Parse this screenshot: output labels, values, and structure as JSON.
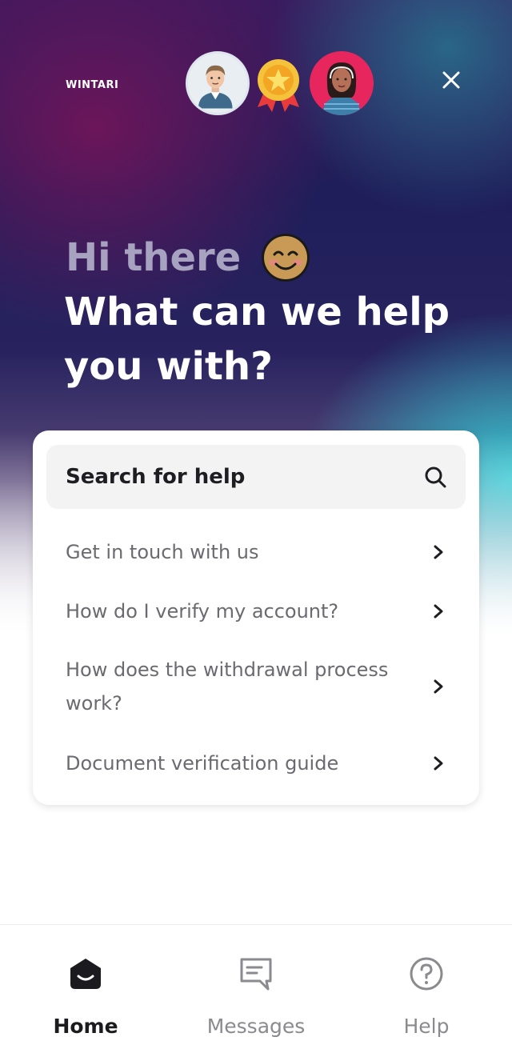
{
  "header": {
    "logo_text": "WINTARI",
    "close_label": "×"
  },
  "hero": {
    "greeting": "Hi there",
    "headline": "What can we help you with?"
  },
  "search": {
    "label": "Search for help"
  },
  "help_items": [
    {
      "label": "Get in touch with us"
    },
    {
      "label": "How do I verify my account?"
    },
    {
      "label": "How does the withdrawal process work?"
    },
    {
      "label": "Document verification guide"
    }
  ],
  "tabs": [
    {
      "label": "Home",
      "icon": "home-icon",
      "active": true
    },
    {
      "label": "Messages",
      "icon": "messages-icon",
      "active": false
    },
    {
      "label": "Help",
      "icon": "help-icon",
      "active": false
    }
  ],
  "colors": {
    "accent": "#e8265e",
    "medal": "#f5a623"
  }
}
